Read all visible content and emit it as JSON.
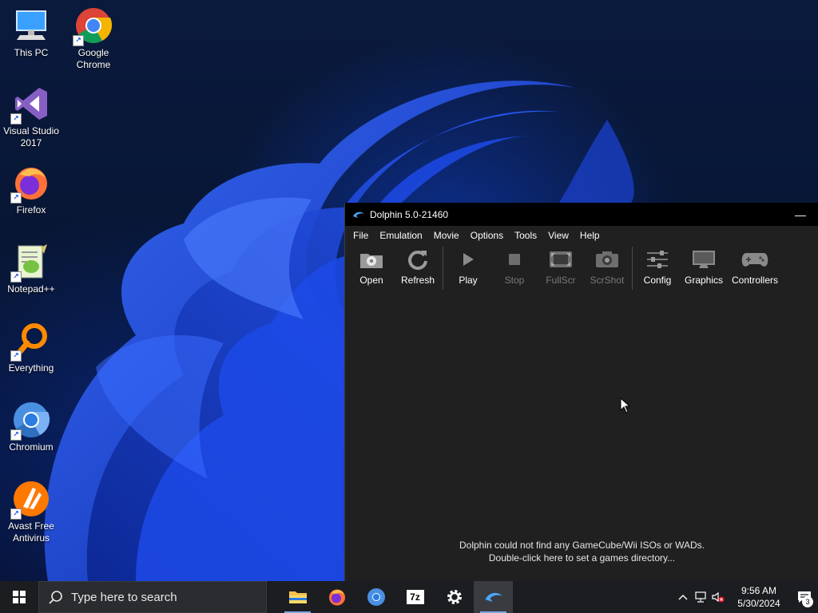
{
  "desktop": {
    "icons": [
      {
        "label": "This PC"
      },
      {
        "label": "Google\nChrome"
      },
      {
        "label": "Visual Studio\n2017"
      },
      {
        "label": "Firefox"
      },
      {
        "label": "Notepad++"
      },
      {
        "label": "Everything"
      },
      {
        "label": "Chromium"
      },
      {
        "label": "Avast Free\nAntivirus"
      }
    ]
  },
  "window": {
    "title": "Dolphin 5.0-21460",
    "minimize": "—",
    "menu": [
      "File",
      "Emulation",
      "Movie",
      "Options",
      "Tools",
      "View",
      "Help"
    ],
    "toolbar": [
      {
        "label": "Open",
        "icon": "open-icon",
        "enabled": true
      },
      {
        "label": "Refresh",
        "icon": "refresh-icon",
        "enabled": true
      },
      {
        "label": "Play",
        "icon": "play-icon",
        "enabled": true
      },
      {
        "label": "Stop",
        "icon": "stop-icon",
        "enabled": false
      },
      {
        "label": "FullScr",
        "icon": "fullscreen-icon",
        "enabled": false
      },
      {
        "label": "ScrShot",
        "icon": "camera-icon",
        "enabled": false
      },
      {
        "label": "Config",
        "icon": "sliders-icon",
        "enabled": true
      },
      {
        "label": "Graphics",
        "icon": "monitor-icon",
        "enabled": true
      },
      {
        "label": "Controllers",
        "icon": "gamepad-icon",
        "enabled": true
      }
    ],
    "empty_line1": "Dolphin could not find any GameCube/Wii ISOs or WADs.",
    "empty_line2": "Double-click here to set a games directory..."
  },
  "taskbar": {
    "search_placeholder": "Type here to search",
    "time": "9:56 AM",
    "date": "5/30/2024",
    "notification_count": "3",
    "seven_zip": "7z"
  },
  "colors": {
    "window_bg": "#202020",
    "titlebar": "#000000",
    "taskbar": "#1c1d21",
    "accent": "#7aa7e0"
  }
}
